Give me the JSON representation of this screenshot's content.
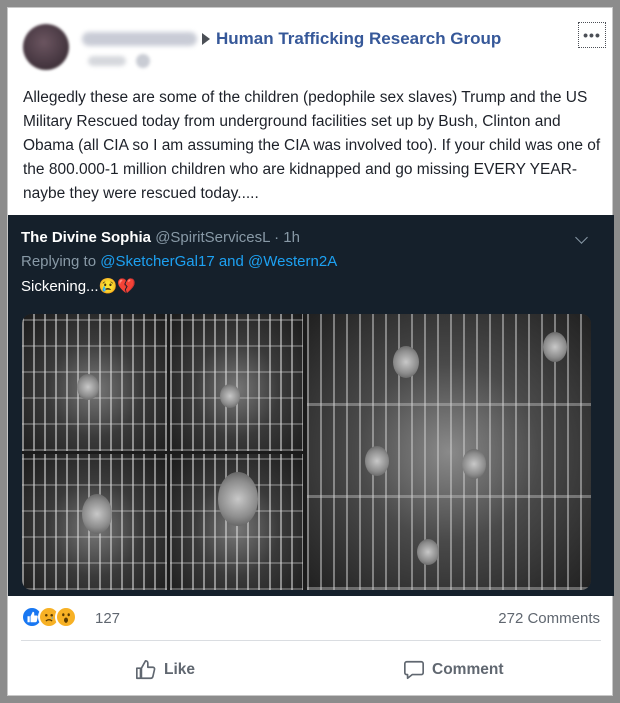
{
  "post": {
    "group_name": "Human Trafficking Research Group",
    "more_label": "•••",
    "text": "Allegedly these are some of the children (pedophile sex slaves) Trump and the US Military Rescued today from underground facilities set up by Bush, Clinton and Obama (all CIA so I am assuming the CIA was involved too). If your child was one of the 800.000-1 million children who are kidnapped and go missing EVERY YEAR-naybe they were rescued today....."
  },
  "tweet": {
    "name": "The Divine Sophia",
    "handle": "@SpiritServicesL",
    "time": " · 1h",
    "replying_prefix": "Replying to ",
    "reply_user_1": "@SketcherGal17",
    "reply_and": " and ",
    "reply_user_2": "@Western2A",
    "text": "Sickening...😢💔"
  },
  "stats": {
    "reactions_count": "127",
    "comments_count": "272 Comments"
  },
  "actions": {
    "like_label": "Like",
    "comment_label": "Comment"
  },
  "colors": {
    "group_link": "#365899",
    "twitter_bg": "#15202b",
    "twitter_link": "#1da1f2",
    "like_blue": "#1877f2"
  }
}
